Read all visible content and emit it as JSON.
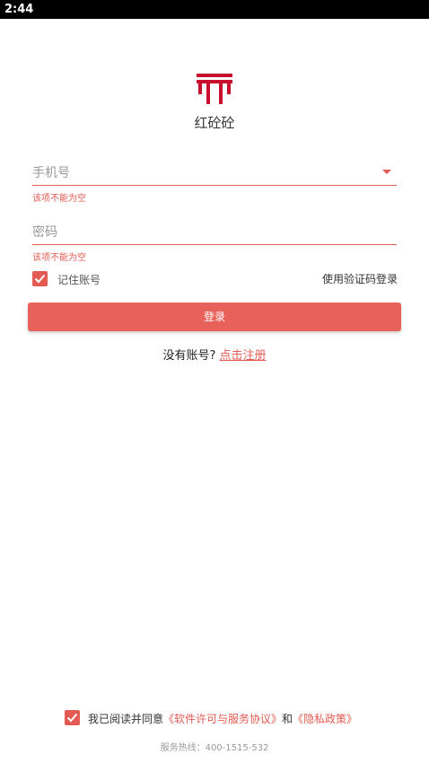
{
  "status_bar": {
    "time": "2:44"
  },
  "app": {
    "name": "红砼砼",
    "brand_color": "#c8102e",
    "accent_color": "#e25a52"
  },
  "form": {
    "phone_placeholder": "手机号",
    "phone_error": "该项不能为空",
    "password_placeholder": "密码",
    "password_error": "该项不能为空",
    "remember_label": "记住账号",
    "remember_checked": true,
    "sms_login_label": "使用验证码登录",
    "login_button_label": "登录"
  },
  "register": {
    "prompt": "没有账号?",
    "link_label": "点击注册"
  },
  "agreement": {
    "checked": true,
    "prefix": "我已阅读并同意",
    "license_link": "《软件许可与服务协议》",
    "conjunction": "和",
    "privacy_link": "《隐私政策》"
  },
  "footer": {
    "hotline": "服务热线：400-1515-532"
  }
}
